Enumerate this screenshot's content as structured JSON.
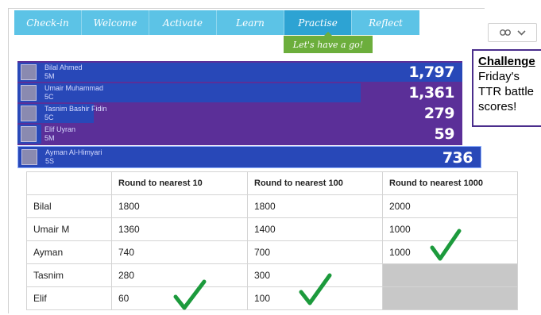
{
  "nav": {
    "tabs": [
      {
        "label": "Check-in"
      },
      {
        "label": "Welcome"
      },
      {
        "label": "Activate"
      },
      {
        "label": "Learn"
      },
      {
        "label": "Practise"
      },
      {
        "label": "Reflect"
      }
    ],
    "active_tab": "Practise",
    "tooltip": "Let's have a go!"
  },
  "challenge": {
    "title": "Challenge",
    "text": "Friday's TTR battle scores!"
  },
  "leaderboard": [
    {
      "name": "Bilal Ahmed",
      "class": "5M",
      "score": "1,797",
      "score_value": 1797
    },
    {
      "name": "Umair Muhammad",
      "class": "5C",
      "score": "1,361",
      "score_value": 1361
    },
    {
      "name": "Tasnim Bashir Fidin",
      "class": "5C",
      "score": "279",
      "score_value": 279
    },
    {
      "name": "Elif Uyran",
      "class": "5M",
      "score": "59",
      "score_value": 59
    },
    {
      "name": "Ayman Al-Himyari",
      "class": "5S",
      "score": "736",
      "score_value": 736
    }
  ],
  "table": {
    "headers": [
      "",
      "Round to nearest 10",
      "Round to nearest 100",
      "Round to nearest 1000"
    ],
    "rows": [
      [
        "Bilal",
        "1800",
        "1800",
        "2000"
      ],
      [
        "Umair M",
        "1360",
        "1400",
        "1000"
      ],
      [
        "Ayman",
        "740",
        "700",
        "1000"
      ],
      [
        "Tasnim",
        "280",
        "300",
        ""
      ],
      [
        "Elif",
        "60",
        "100",
        ""
      ]
    ]
  },
  "colors": {
    "tab": "#5cc3e6",
    "tab_active": "#2da3d3",
    "tooltip": "#6cae3c",
    "board": "#5b2f98",
    "bar": "#2848b8",
    "tick": "#1c9a3c"
  },
  "icons": [
    "link-icon",
    "chevron-down-icon",
    "checkmark-icon"
  ]
}
